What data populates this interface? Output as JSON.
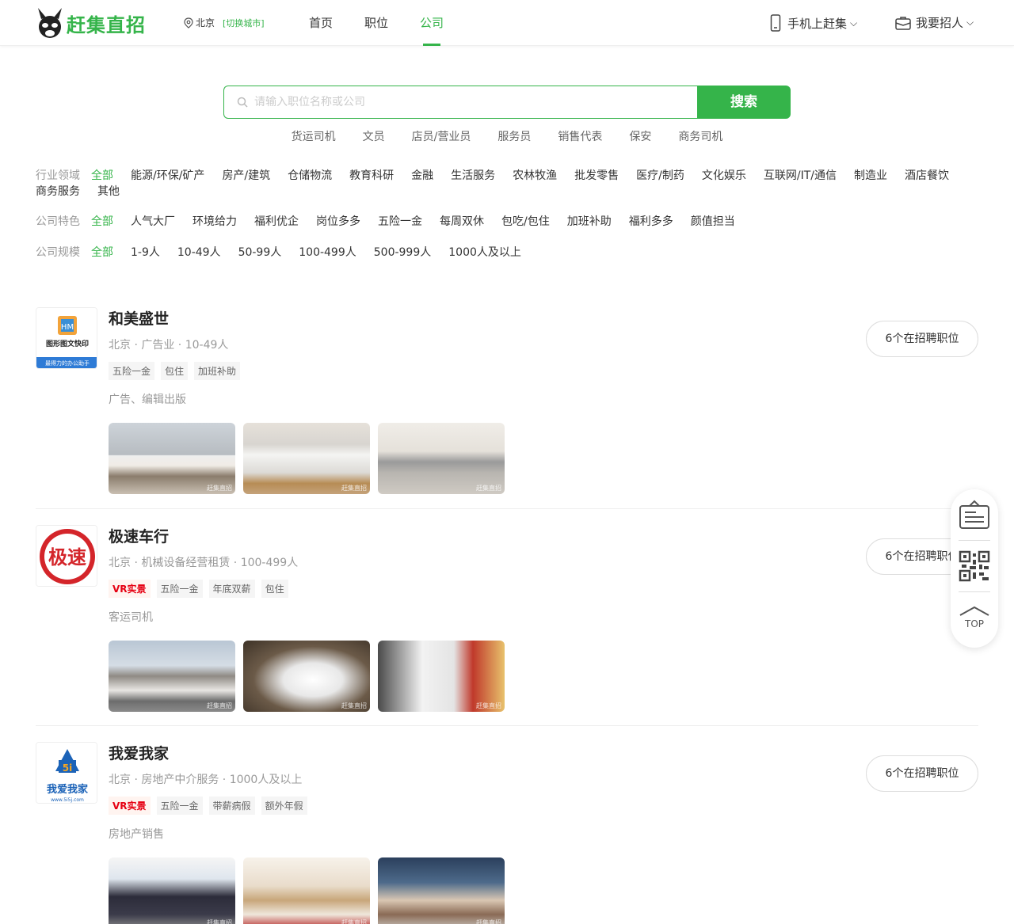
{
  "header": {
    "brand": "赶集直招",
    "city": "北京",
    "city_switch": "[切换城市]",
    "nav": [
      "首页",
      "职位",
      "公司"
    ],
    "mobile": "手机上赶集",
    "recruit": "我要招人"
  },
  "search": {
    "placeholder": "请输入职位名称或公司",
    "button": "搜索",
    "hot": [
      "货运司机",
      "文员",
      "店员/营业员",
      "服务员",
      "销售代表",
      "保安",
      "商务司机"
    ]
  },
  "filters": {
    "industry": {
      "label": "行业领域",
      "options": [
        "全部",
        "能源/环保/矿产",
        "房产/建筑",
        "仓储物流",
        "教育科研",
        "金融",
        "生活服务",
        "农林牧渔",
        "批发零售",
        "医疗/制药",
        "文化娱乐",
        "互联网/IT/通信",
        "制造业",
        "酒店餐饮",
        "商务服务",
        "其他"
      ]
    },
    "feature": {
      "label": "公司特色",
      "options": [
        "全部",
        "人气大厂",
        "环境给力",
        "福利优企",
        "岗位多多",
        "五险一金",
        "每周双休",
        "包吃/包住",
        "加班补助",
        "福利多多",
        "颜值担当"
      ]
    },
    "size": {
      "label": "公司规模",
      "options": [
        "全部",
        "1-9人",
        "10-49人",
        "50-99人",
        "100-499人",
        "500-999人",
        "1000人及以上"
      ]
    }
  },
  "companies": [
    {
      "name": "和美盛世",
      "meta": "北京 · 广告业 · 10-49人",
      "vr": "",
      "tags": [
        "五险一金",
        "包住",
        "加班补助"
      ],
      "desc": "广告、编辑出版",
      "jobs": "6个在招聘职位",
      "logo_text": "和美盛世",
      "logo_sub": "图形图文快印",
      "logo_band": "最得力的办公助手"
    },
    {
      "name": "极速车行",
      "meta": "北京 · 机械设备经营租赁 · 100-499人",
      "vr": "VR实景",
      "tags": [
        "五险一金",
        "年底双薪",
        "包住"
      ],
      "desc": "客运司机",
      "jobs": "6个在招聘职位",
      "logo_text": "极速"
    },
    {
      "name": "我爱我家",
      "meta": "北京 · 房地产中介服务 · 1000人及以上",
      "vr": "VR实景",
      "tags": [
        "五险一金",
        "带薪病假",
        "额外年假"
      ],
      "desc": "房地产销售",
      "jobs": "6个在招聘职位",
      "logo_text": "我爱我家",
      "logo_sub": "www.5i5j.com"
    }
  ],
  "photo_watermark": "赶集直招",
  "float": {
    "top": "TOP"
  },
  "colors": {
    "accent": "#35b44a"
  }
}
